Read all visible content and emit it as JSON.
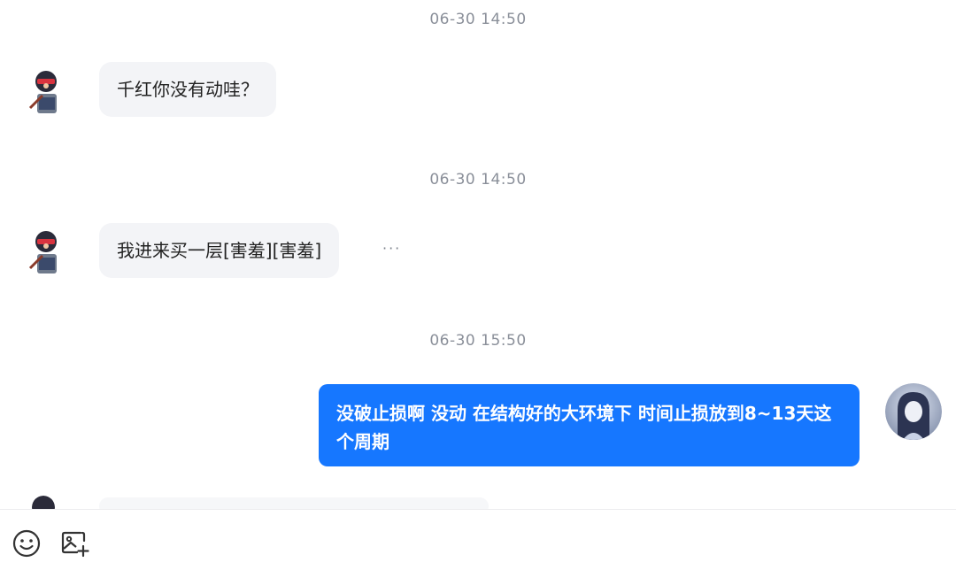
{
  "messages": [
    {
      "type": "time",
      "text": "06-30 14:50"
    },
    {
      "type": "incoming",
      "text": "千红你没有动哇？"
    },
    {
      "type": "time",
      "text": "06-30 14:50"
    },
    {
      "type": "incoming",
      "text": "我进来买一层[害羞][害羞]",
      "more": "···"
    },
    {
      "type": "time",
      "text": "06-30 15:50"
    },
    {
      "type": "outgoing",
      "text": "没破止损啊 没动 在结构好的大环境下 时间止损放到8~13天这个周期"
    }
  ],
  "toolbar": {
    "icons": [
      "emoji-icon",
      "image-add-icon"
    ]
  },
  "colors": {
    "outgoing_bubble": "#1677ff",
    "incoming_bubble": "#f3f4f7",
    "timestamp": "#8a8f99"
  }
}
